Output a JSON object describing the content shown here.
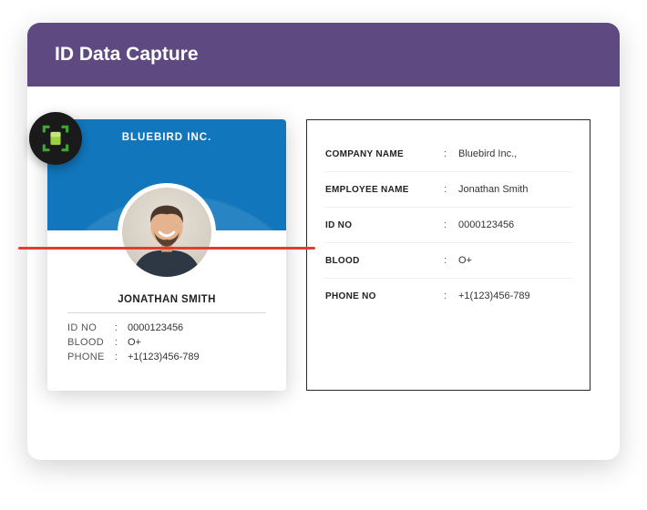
{
  "header": {
    "title": "ID Data Capture"
  },
  "card": {
    "company": "BLUEBIRD INC.",
    "name": "JONATHAN SMITH",
    "fields": {
      "idno_label": "ID NO",
      "idno_value": "0000123456",
      "blood_label": "BLOOD",
      "blood_value": "O+",
      "phone_label": "PHONE",
      "phone_value": "+1(123)456-789"
    }
  },
  "results": {
    "company_label": "COMPANY NAME",
    "company_value": "Bluebird Inc.,",
    "employee_label": "EMPLOYEE NAME",
    "employee_value": "Jonathan Smith",
    "idno_label": "ID NO",
    "idno_value": "0000123456",
    "blood_label": "BLOOD",
    "blood_value": "O+",
    "phone_label": "PHONE NO",
    "phone_value": "+1(123)456-789"
  },
  "colon": ":"
}
